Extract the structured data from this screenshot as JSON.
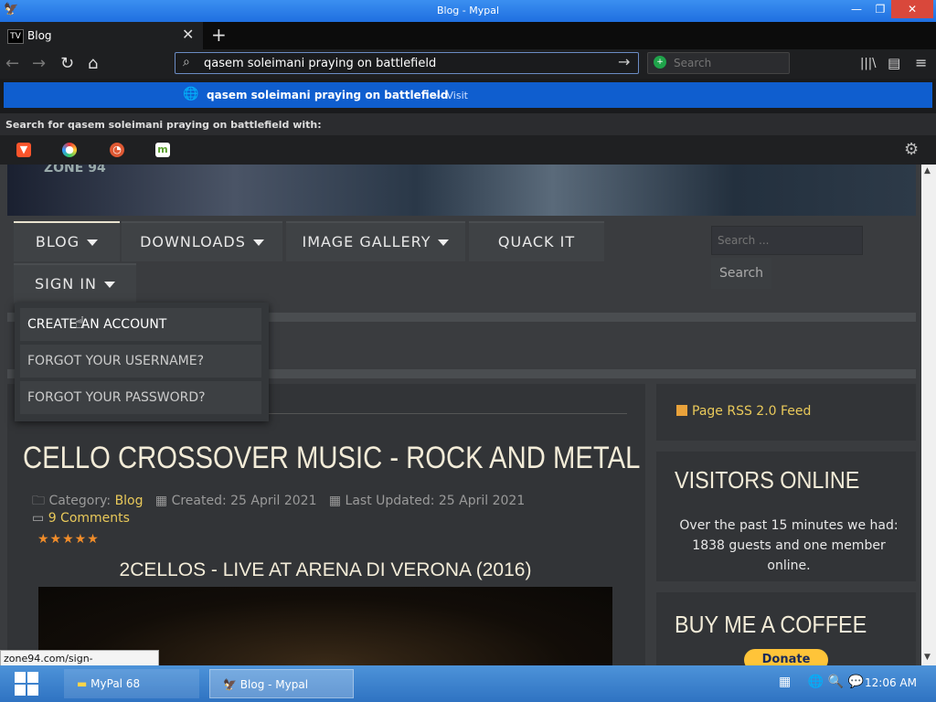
{
  "window": {
    "title": "Blog - Mypal",
    "min": "—",
    "max": "❐",
    "close": "✕"
  },
  "tabs": [
    {
      "label": "Blog",
      "favicon": "TV"
    }
  ],
  "toolbar": {
    "url": "qasem soleimani praying on battlefield",
    "search_placeholder": "Search",
    "back": "←",
    "forward": "→",
    "reload": "↻",
    "home": "⌂",
    "go": "→",
    "library": "|||\\",
    "sidebar": "▤",
    "menu": "≡"
  },
  "suggestion": {
    "query": "qasem soleimani praying on battlefield",
    "visit": "— Visit"
  },
  "search_with": {
    "label": "Search for qasem soleimani praying on battlefield with:"
  },
  "engines": [
    {
      "name": "brave",
      "color": "#fb542b"
    },
    {
      "name": "qwant",
      "color": "#5c57d9"
    },
    {
      "name": "duckduckgo",
      "color": "#de5833"
    },
    {
      "name": "mojeek",
      "color": "#7ab93a"
    }
  ],
  "site": {
    "logo": "ZONE 94",
    "menu": {
      "blog": "BLOG",
      "downloads": "DOWNLOADS",
      "gallery": "IMAGE GALLERY",
      "quack": "QUACK IT",
      "signin": "SIGN IN"
    },
    "search_placeholder": "Search ...",
    "search_button": "Search",
    "dropdown": {
      "create": "CREATE AN ACCOUNT",
      "username": "FORGOT YOUR USERNAME?",
      "password": "FORGOT YOUR PASSWORD?"
    }
  },
  "article": {
    "title": "CELLO CROSSOVER MUSIC - ROCK AND METAL",
    "category_label": "Category:",
    "category": "Blog",
    "created": "Created: 25 April 2021",
    "updated": "Last Updated: 25 April 2021",
    "comments": "9 Comments",
    "stars": "★★★★★",
    "video_title": "2CELLOS - LIVE AT ARENA DI VERONA (2016)"
  },
  "sidebar": {
    "rss": "Page RSS 2.0 Feed",
    "visitors_title": "VISITORS ONLINE",
    "visitors_text": "Over the past 15 minutes we had: 1838 guests and one member online.",
    "coffee_title": "BUY ME A COFFEE",
    "donate": "Donate"
  },
  "status_url": "zone94.com/sign-in/registration",
  "taskbar": {
    "mypal": "MyPal 68",
    "blog": "Blog - Mypal",
    "clock": "12:06 AM"
  },
  "colors": {
    "accent": "#e9c95a",
    "title": "#f3ecd8",
    "blue": "#0f5ecf"
  }
}
